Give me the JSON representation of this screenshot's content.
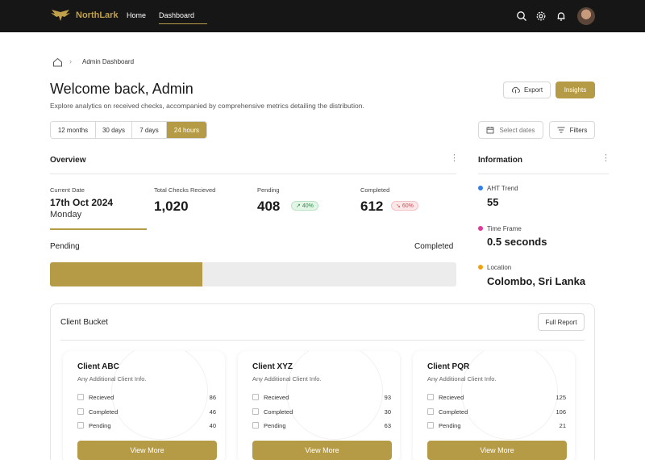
{
  "nav": {
    "brand": "NorthLark",
    "home": "Home",
    "dashboard": "Dashboard",
    "icons": [
      "search-icon",
      "gear-icon",
      "bell-icon"
    ],
    "accent": "#b59b45",
    "background": "#161616"
  },
  "breadcrumb": {
    "current": "Admin Dashboard"
  },
  "header": {
    "title": "Welcome back, Admin",
    "subtitle": "Explore analytics on received checks, accompanied by comprehensive metrics detailing the distribution.",
    "export_label": "Export",
    "insights_label": "Insights"
  },
  "ranges": {
    "options": [
      "12 months",
      "30 days",
      "7 days",
      "24 hours"
    ],
    "selected": "24 hours"
  },
  "filters": {
    "dates_label": "Select dates",
    "filters_label": "Filters"
  },
  "overview": {
    "title": "Overview",
    "current_date_label": "Current Date",
    "current_date": "17th Oct 2024",
    "current_day": "Monday",
    "total_label": "Total Checks Recieved",
    "total_value": "1,020",
    "pending_label": "Pending",
    "pending_value": "408",
    "pending_change": "40%",
    "completed_label": "Completed",
    "completed_value": "612",
    "completed_change": "60%",
    "bar_left_label": "Pending",
    "bar_right_label": "Completed",
    "pending_fraction": 0.375
  },
  "information": {
    "title": "Information",
    "items": [
      {
        "label": "AHT Trend",
        "value": "55",
        "color": "#2f80ed"
      },
      {
        "label": "Time Frame",
        "value": "0.5 seconds",
        "color": "#e0399a"
      },
      {
        "label": "Location",
        "value": "Colombo, Sri Lanka",
        "color": "#f2a20c"
      }
    ]
  },
  "bucket": {
    "title": "Client Bucket",
    "report_label": "Full Report",
    "clients": [
      {
        "name": "Client ABC",
        "sub": "Any Additional Client Info.",
        "rows": [
          {
            "label": "Recieved",
            "count": "86"
          },
          {
            "label": "Completed",
            "count": "46"
          },
          {
            "label": "Pending",
            "count": "40"
          }
        ],
        "button": "View More"
      },
      {
        "name": "Client XYZ",
        "sub": "Any Additional Client Info.",
        "rows": [
          {
            "label": "Recieved",
            "count": "93"
          },
          {
            "label": "Completed",
            "count": "30"
          },
          {
            "label": "Pending",
            "count": "63"
          }
        ],
        "button": "View More"
      },
      {
        "name": "Client PQR",
        "sub": "Any Additional Client Info.",
        "rows": [
          {
            "label": "Recieved",
            "count": "125"
          },
          {
            "label": "Completed",
            "count": "106"
          },
          {
            "label": "Pending",
            "count": "21"
          }
        ],
        "button": "View More"
      }
    ]
  }
}
